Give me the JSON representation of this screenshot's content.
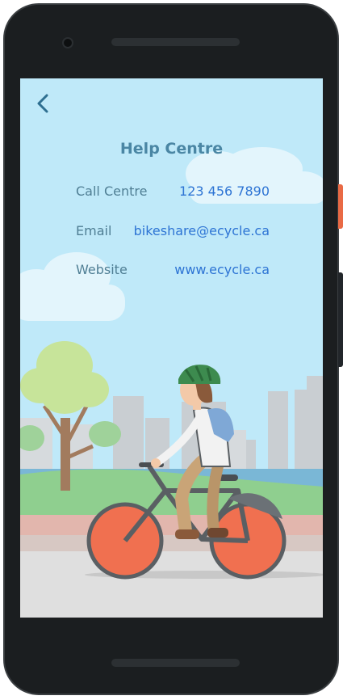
{
  "screen": {
    "back_icon": "chevron-left-icon",
    "title": "Help Centre",
    "contacts": [
      {
        "label": "Call Centre",
        "value": "123 456 7890"
      },
      {
        "label": "Email",
        "value": "bikeshare@ecycle.ca"
      },
      {
        "label": "Website",
        "value": "www.ecycle.ca"
      }
    ]
  },
  "colors": {
    "sky": "#bfe9f9",
    "title": "#4a86a4",
    "label": "#4f7e94",
    "link": "#2d74d4",
    "wheel": "#f07050",
    "helmet": "#3d8b4f"
  },
  "illustration": "cyclist-icon"
}
